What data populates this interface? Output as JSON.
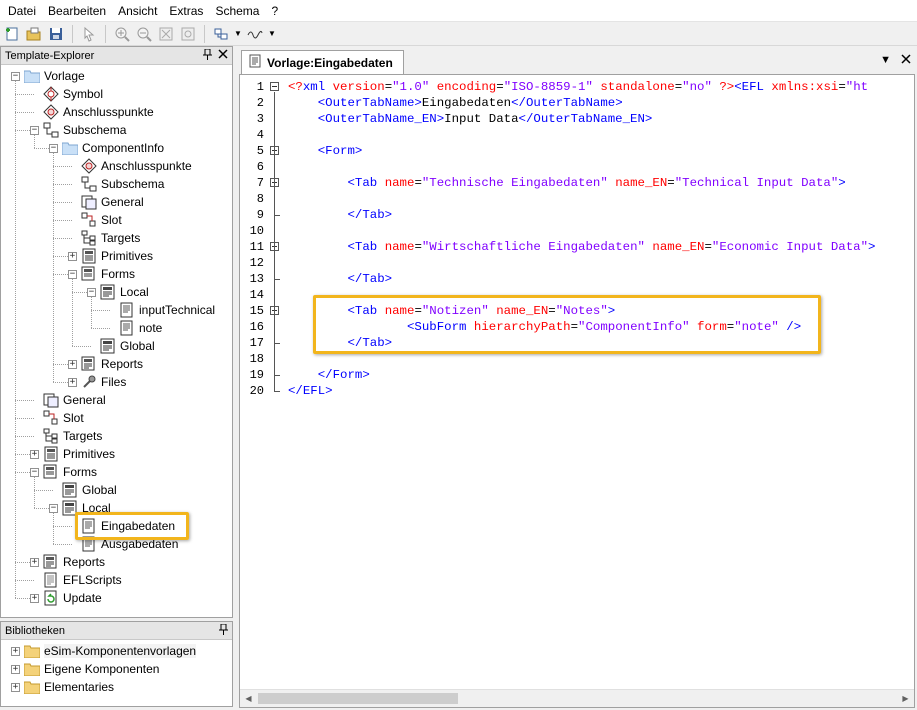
{
  "menu": [
    "Datei",
    "Bearbeiten",
    "Ansicht",
    "Extras",
    "Schema",
    "?"
  ],
  "explorer": {
    "title": "Template-Explorer",
    "tree": [
      {
        "label": "Vorlage",
        "icon": "folder-icon",
        "level": 0,
        "expander": "-"
      },
      {
        "label": "Symbol",
        "icon": "symbol-icon",
        "level": 1,
        "expander": ""
      },
      {
        "label": "Anschlusspunkte",
        "icon": "connector-icon",
        "level": 1,
        "expander": ""
      },
      {
        "label": "Subschema",
        "icon": "subschema-icon",
        "level": 1,
        "expander": "-"
      },
      {
        "label": "ComponentInfo",
        "icon": "folder-icon",
        "level": 2,
        "expander": "-"
      },
      {
        "label": "Anschlusspunkte",
        "icon": "connector-icon",
        "level": 3,
        "expander": ""
      },
      {
        "label": "Subschema",
        "icon": "subschema-icon",
        "level": 3,
        "expander": ""
      },
      {
        "label": "General",
        "icon": "general-icon",
        "level": 3,
        "expander": ""
      },
      {
        "label": "Slot",
        "icon": "slot-icon",
        "level": 3,
        "expander": ""
      },
      {
        "label": "Targets",
        "icon": "targets-icon",
        "level": 3,
        "expander": ""
      },
      {
        "label": "Primitives",
        "icon": "primitives-icon",
        "level": 3,
        "expander": "+"
      },
      {
        "label": "Forms",
        "icon": "forms-icon",
        "level": 3,
        "expander": "-"
      },
      {
        "label": "Local",
        "icon": "form-icon",
        "level": 4,
        "expander": "-"
      },
      {
        "label": "inputTechnical",
        "icon": "document-icon",
        "level": 5,
        "expander": ""
      },
      {
        "label": "note",
        "icon": "document-icon",
        "level": 5,
        "expander": ""
      },
      {
        "label": "Global",
        "icon": "form-icon",
        "level": 4,
        "expander": ""
      },
      {
        "label": "Reports",
        "icon": "reports-icon",
        "level": 3,
        "expander": "+"
      },
      {
        "label": "Files",
        "icon": "files-icon",
        "level": 3,
        "expander": "+"
      },
      {
        "label": "General",
        "icon": "general-icon",
        "level": 1,
        "expander": ""
      },
      {
        "label": "Slot",
        "icon": "slot-icon",
        "level": 1,
        "expander": ""
      },
      {
        "label": "Targets",
        "icon": "targets-icon",
        "level": 1,
        "expander": ""
      },
      {
        "label": "Primitives",
        "icon": "primitives-icon",
        "level": 1,
        "expander": "+"
      },
      {
        "label": "Forms",
        "icon": "forms-icon",
        "level": 1,
        "expander": "-"
      },
      {
        "label": "Global",
        "icon": "form-icon",
        "level": 2,
        "expander": ""
      },
      {
        "label": "Local",
        "icon": "form-icon",
        "level": 2,
        "expander": "-"
      },
      {
        "label": "Eingabedaten",
        "icon": "document-icon",
        "level": 3,
        "expander": ""
      },
      {
        "label": "Ausgabedaten",
        "icon": "document-icon",
        "level": 3,
        "expander": ""
      },
      {
        "label": "Reports",
        "icon": "reports-icon",
        "level": 1,
        "expander": "+"
      },
      {
        "label": "EFLScripts",
        "icon": "scripts-icon",
        "level": 1,
        "expander": ""
      },
      {
        "label": "Update",
        "icon": "update-icon",
        "level": 1,
        "expander": "+"
      }
    ]
  },
  "libraries": {
    "title": "Bibliotheken",
    "items": [
      "eSim-Komponentenvorlagen",
      "Eigene Komponenten",
      "Elementaries"
    ]
  },
  "editor": {
    "tab_label": "Vorlage:Eingabedaten",
    "lines": [
      [
        [
          "pi",
          "<?"
        ],
        [
          "tag",
          "xml"
        ],
        [
          "text",
          " "
        ],
        [
          "attr",
          "version"
        ],
        [
          "text",
          "="
        ],
        [
          "val",
          "\"1.0\""
        ],
        [
          "text",
          " "
        ],
        [
          "attr",
          "encoding"
        ],
        [
          "text",
          "="
        ],
        [
          "val",
          "\"ISO-8859-1\""
        ],
        [
          "text",
          " "
        ],
        [
          "attr",
          "standalone"
        ],
        [
          "text",
          "="
        ],
        [
          "val",
          "\"no\""
        ],
        [
          "text",
          " "
        ],
        [
          "pi",
          "?>"
        ],
        [
          "tag",
          "<EFL"
        ],
        [
          "text",
          " "
        ],
        [
          "attr",
          "xmlns:xsi"
        ],
        [
          "text",
          "="
        ],
        [
          "val",
          "\"ht"
        ]
      ],
      [
        [
          "text",
          "    "
        ],
        [
          "tag",
          "<OuterTabName>"
        ],
        [
          "text",
          "Eingabedaten"
        ],
        [
          "tag",
          "</OuterTabName>"
        ]
      ],
      [
        [
          "text",
          "    "
        ],
        [
          "tag",
          "<OuterTabName_EN>"
        ],
        [
          "text",
          "Input Data"
        ],
        [
          "tag",
          "</OuterTabName_EN>"
        ]
      ],
      [],
      [
        [
          "text",
          "    "
        ],
        [
          "tag",
          "<Form>"
        ]
      ],
      [],
      [
        [
          "text",
          "        "
        ],
        [
          "tag",
          "<Tab"
        ],
        [
          "text",
          " "
        ],
        [
          "attr",
          "name"
        ],
        [
          "text",
          "="
        ],
        [
          "val",
          "\"Technische Eingabedaten\""
        ],
        [
          "text",
          " "
        ],
        [
          "attr",
          "name_EN"
        ],
        [
          "text",
          "="
        ],
        [
          "val",
          "\"Technical Input Data\""
        ],
        [
          "tag",
          ">"
        ]
      ],
      [],
      [
        [
          "text",
          "        "
        ],
        [
          "tag",
          "</Tab>"
        ]
      ],
      [],
      [
        [
          "text",
          "        "
        ],
        [
          "tag",
          "<Tab"
        ],
        [
          "text",
          " "
        ],
        [
          "attr",
          "name"
        ],
        [
          "text",
          "="
        ],
        [
          "val",
          "\"Wirtschaftliche Eingabedaten\""
        ],
        [
          "text",
          " "
        ],
        [
          "attr",
          "name_EN"
        ],
        [
          "text",
          "="
        ],
        [
          "val",
          "\"Economic Input Data\""
        ],
        [
          "tag",
          ">"
        ]
      ],
      [],
      [
        [
          "text",
          "        "
        ],
        [
          "tag",
          "</Tab>"
        ]
      ],
      [],
      [
        [
          "text",
          "        "
        ],
        [
          "tag",
          "<Tab"
        ],
        [
          "text",
          " "
        ],
        [
          "attr",
          "name"
        ],
        [
          "text",
          "="
        ],
        [
          "val",
          "\"Notizen\""
        ],
        [
          "text",
          " "
        ],
        [
          "attr",
          "name_EN"
        ],
        [
          "text",
          "="
        ],
        [
          "val",
          "\"Notes\""
        ],
        [
          "tag",
          ">"
        ]
      ],
      [
        [
          "text",
          "                "
        ],
        [
          "tag",
          "<SubForm"
        ],
        [
          "text",
          " "
        ],
        [
          "attr",
          "hierarchyPath"
        ],
        [
          "text",
          "="
        ],
        [
          "val",
          "\"ComponentInfo\""
        ],
        [
          "text",
          " "
        ],
        [
          "attr",
          "form"
        ],
        [
          "text",
          "="
        ],
        [
          "val",
          "\"note\""
        ],
        [
          "text",
          " "
        ],
        [
          "tag",
          "/>"
        ]
      ],
      [
        [
          "text",
          "        "
        ],
        [
          "tag",
          "</Tab>"
        ]
      ],
      [],
      [
        [
          "text",
          "    "
        ],
        [
          "tag",
          "</Form>"
        ]
      ],
      [
        [
          "tag",
          "</EFL>"
        ]
      ]
    ],
    "fold_starts": [
      1,
      5,
      7,
      11,
      15
    ]
  },
  "colors": {
    "tag": "#0000ff",
    "attr": "#ff0000",
    "value": "#8000ff",
    "highlight": "#f2b51c"
  }
}
